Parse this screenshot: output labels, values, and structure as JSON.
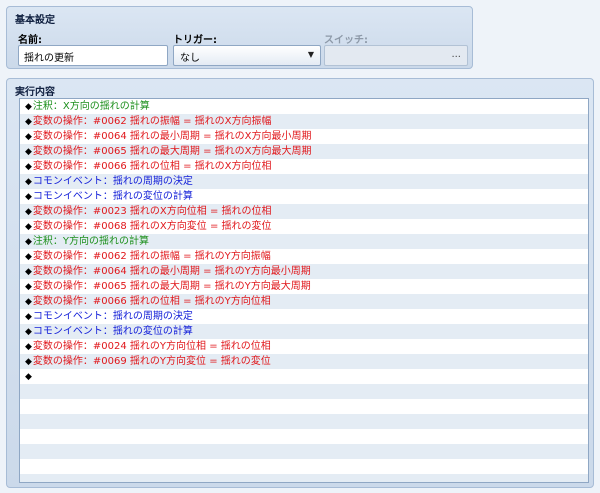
{
  "basic": {
    "title": "基本設定",
    "name_label": "名前:",
    "name_value": "揺れの更新",
    "trigger_label": "トリガー:",
    "trigger_value": "なし",
    "switch_label": "スイッチ:",
    "switch_button": "..."
  },
  "content": {
    "title": "実行内容",
    "diamond": "◆",
    "rows": [
      {
        "kind": "comment",
        "color": "#1c8f1c",
        "text": "注釈：X方向の揺れの計算"
      },
      {
        "kind": "variable",
        "color": "#e0171b",
        "text": "変数の操作：#0062 揺れの振幅 = 揺れのX方向振幅"
      },
      {
        "kind": "variable",
        "color": "#e0171b",
        "text": "変数の操作：#0064 揺れの最小周期 = 揺れのX方向最小周期"
      },
      {
        "kind": "variable",
        "color": "#e0171b",
        "text": "変数の操作：#0065 揺れの最大周期 = 揺れのX方向最大周期"
      },
      {
        "kind": "variable",
        "color": "#e0171b",
        "text": "変数の操作：#0066 揺れの位相 = 揺れのX方向位相"
      },
      {
        "kind": "common",
        "color": "#1420d8",
        "text": "コモンイベント：揺れの周期の決定"
      },
      {
        "kind": "common",
        "color": "#1420d8",
        "text": "コモンイベント：揺れの変位の計算"
      },
      {
        "kind": "variable",
        "color": "#e0171b",
        "text": "変数の操作：#0023 揺れのX方向位相 = 揺れの位相"
      },
      {
        "kind": "variable",
        "color": "#e0171b",
        "text": "変数の操作：#0068 揺れのX方向変位 = 揺れの変位"
      },
      {
        "kind": "comment",
        "color": "#1c8f1c",
        "text": "注釈：Y方向の揺れの計算"
      },
      {
        "kind": "variable",
        "color": "#e0171b",
        "text": "変数の操作：#0062 揺れの振幅 = 揺れのY方向振幅"
      },
      {
        "kind": "variable",
        "color": "#e0171b",
        "text": "変数の操作：#0064 揺れの最小周期 = 揺れのY方向最小周期"
      },
      {
        "kind": "variable",
        "color": "#e0171b",
        "text": "変数の操作：#0065 揺れの最大周期 = 揺れのY方向最大周期"
      },
      {
        "kind": "variable",
        "color": "#e0171b",
        "text": "変数の操作：#0066 揺れの位相 = 揺れのY方向位相"
      },
      {
        "kind": "common",
        "color": "#1420d8",
        "text": "コモンイベント：揺れの周期の決定"
      },
      {
        "kind": "common",
        "color": "#1420d8",
        "text": "コモンイベント：揺れの変位の計算"
      },
      {
        "kind": "variable",
        "color": "#e0171b",
        "text": "変数の操作：#0024 揺れのY方向位相 = 揺れの位相"
      },
      {
        "kind": "variable",
        "color": "#e0171b",
        "text": "変数の操作：#0069 揺れのY方向変位 = 揺れの変位"
      },
      {
        "kind": "empty",
        "color": "#000000",
        "text": ""
      }
    ]
  }
}
